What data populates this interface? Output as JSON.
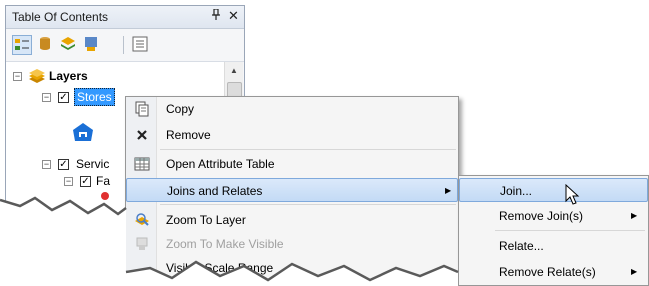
{
  "toc": {
    "title": "Table Of Contents",
    "pin_glyph": "ᵖ",
    "close_glyph": "✕",
    "toolbar_icons": [
      "list-by-drawing-order-icon",
      "list-by-source-icon",
      "list-by-visibility-icon",
      "list-by-selection-icon",
      "options-icon"
    ],
    "tree": {
      "root_label": "Layers",
      "stores_label": "Stores",
      "service_label": "Servic",
      "fa_label": "Fa"
    }
  },
  "context_menu": {
    "items": [
      {
        "label": "Copy",
        "icon": "copy-icon"
      },
      {
        "label": "Remove",
        "icon": "remove-x-icon"
      },
      {
        "label": "Open Attribute Table",
        "icon": "table-icon"
      },
      {
        "label": "Joins and Relates",
        "icon": "",
        "submenu": true
      },
      {
        "label": "Zoom To Layer",
        "icon": "zoom-to-layer-icon"
      },
      {
        "label": "Zoom To Make Visible",
        "icon": "zoom-to-make-visible-icon",
        "disabled": true
      },
      {
        "label": "Visible Scale Range",
        "icon": ""
      }
    ]
  },
  "submenu": {
    "items": [
      {
        "label": "Join...",
        "submenu": false
      },
      {
        "label": "Remove Join(s)",
        "submenu": true
      },
      {
        "label": "Relate...",
        "submenu": false
      },
      {
        "label": "Remove Relate(s)",
        "submenu": true
      }
    ]
  },
  "colors": {
    "selection": "#3399ff",
    "menu_highlight": "#c3daf5",
    "layer_icon": "#e8a400",
    "store_icon": "#1a6fd6"
  }
}
